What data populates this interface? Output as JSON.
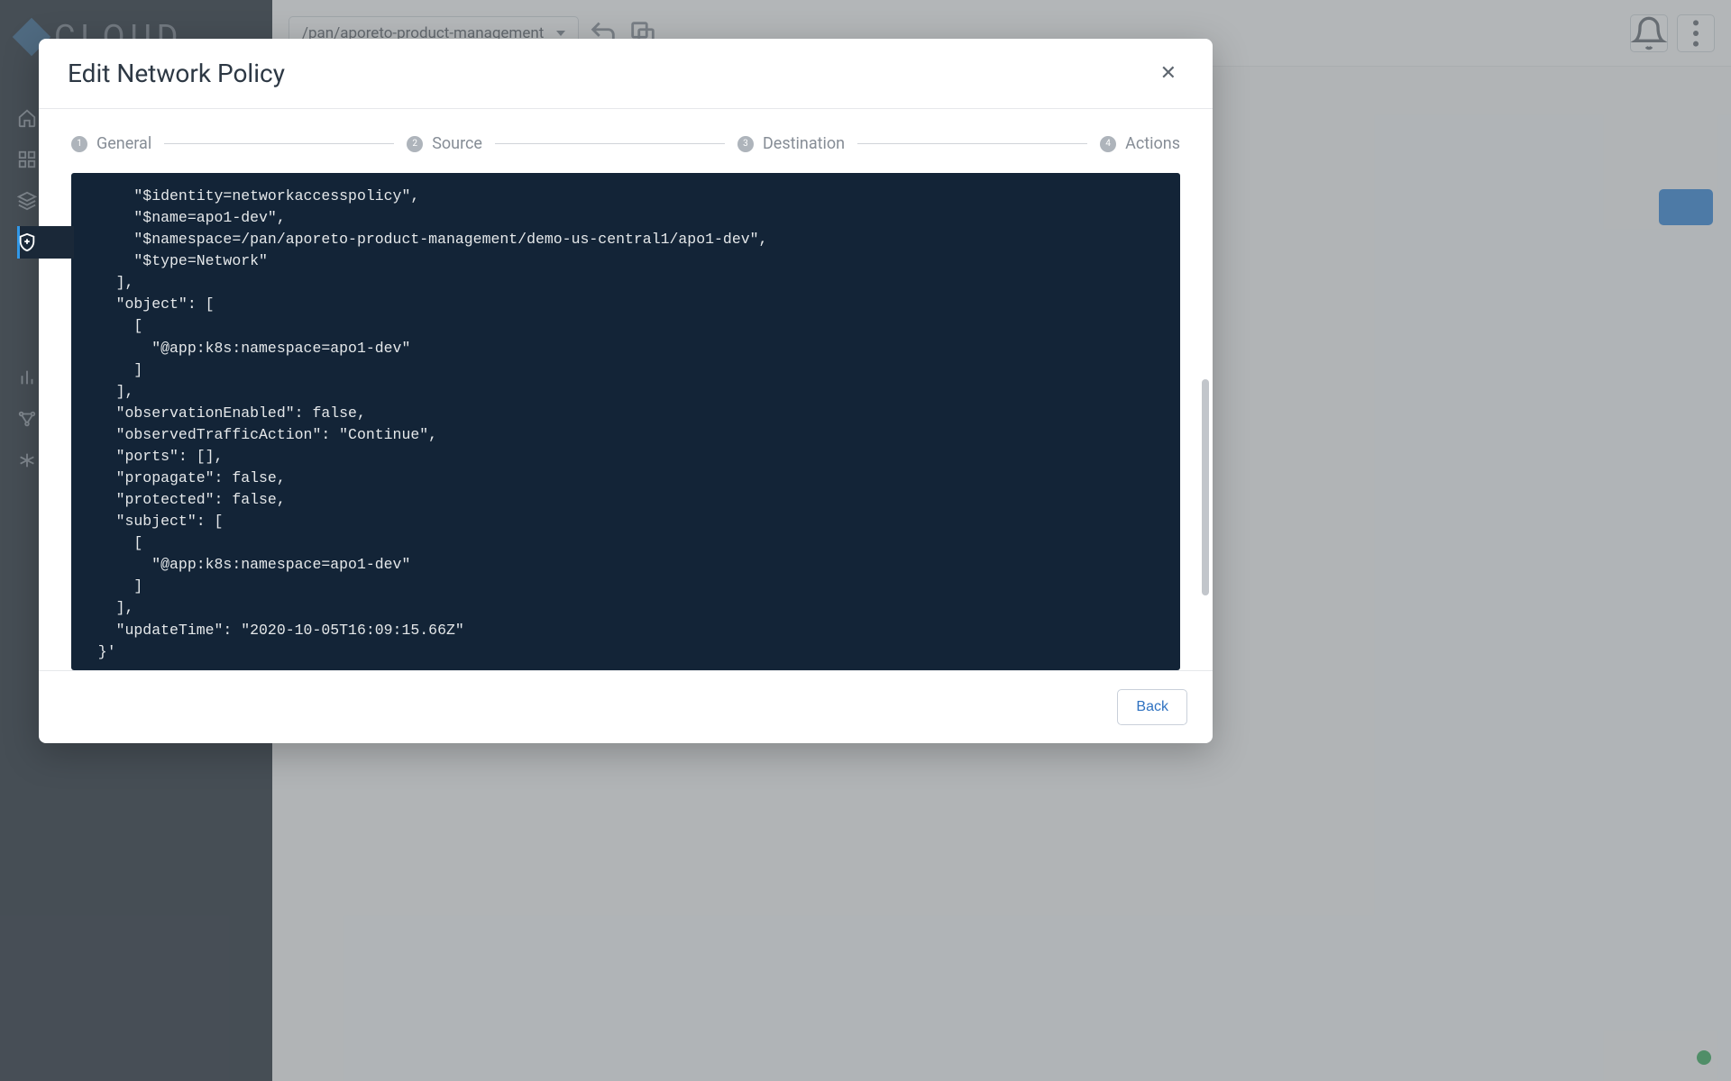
{
  "app": {
    "logo_text": "CLOUD"
  },
  "topbar": {
    "breadcrumb": "/pan/aporeto-product-management"
  },
  "modal": {
    "title": "Edit Network Policy",
    "steps": [
      {
        "num": "1",
        "label": "General"
      },
      {
        "num": "2",
        "label": "Source"
      },
      {
        "num": "3",
        "label": "Destination"
      },
      {
        "num": "4",
        "label": "Actions"
      }
    ],
    "code": "      \"$identity=networkaccesspolicy\",\n      \"$name=apo1-dev\",\n      \"$namespace=/pan/aporeto-product-management/demo-us-central1/apo1-dev\",\n      \"$type=Network\"\n    ],\n    \"object\": [\n      [\n        \"@app:k8s:namespace=apo1-dev\"\n      ]\n    ],\n    \"observationEnabled\": false,\n    \"observedTrafficAction\": \"Continue\",\n    \"ports\": [],\n    \"propagate\": false,\n    \"protected\": false,\n    \"subject\": [\n      [\n        \"@app:k8s:namespace=apo1-dev\"\n      ]\n    ],\n    \"updateTime\": \"2020-10-05T16:09:15.66Z\"\n  }'",
    "back_label": "Back"
  }
}
